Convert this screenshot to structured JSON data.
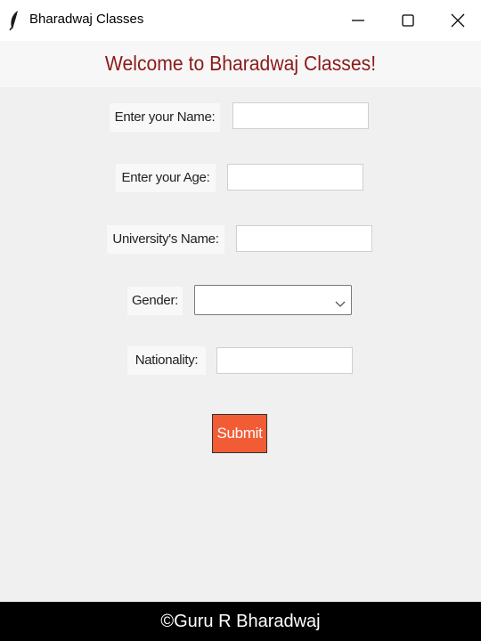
{
  "window": {
    "title": "Bharadwaj Classes",
    "icon": "feather-icon",
    "controls": [
      "minimize-icon",
      "maximize-icon",
      "close-icon"
    ]
  },
  "header": {
    "welcome_text": "Welcome to Bharadwaj Classes!",
    "color": "#8b1a1a"
  },
  "form": {
    "name_label": "Enter your Name:",
    "name_value": "",
    "age_label": "Enter your Age:",
    "age_value": "",
    "university_label": "University's Name:",
    "university_value": "",
    "gender_label": "Gender:",
    "gender_value": "",
    "nationality_label": "Nationality:",
    "nationality_value": "",
    "submit_label": "Submit",
    "submit_color": "#f25c34"
  },
  "footer": {
    "text": "©Guru R Bharadwaj"
  }
}
